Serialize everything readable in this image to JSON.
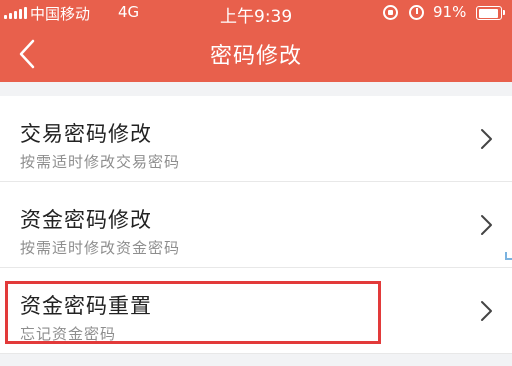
{
  "status_bar": {
    "carrier": "中国移动",
    "network": "4G",
    "time": "上午9:39",
    "battery": "91%",
    "battery_level": 0.91,
    "icons": [
      "signal-icon",
      "rotation-lock-icon",
      "alarm-icon",
      "battery-icon"
    ]
  },
  "nav": {
    "title": "密码修改",
    "back_icon": "chevron-left-icon"
  },
  "items": [
    {
      "title": "交易密码修改",
      "subtitle": "按需适时修改交易密码"
    },
    {
      "title": "资金密码修改",
      "subtitle": "按需适时修改资金密码"
    },
    {
      "title": "资金密码重置",
      "subtitle": "忘记资金密码"
    }
  ],
  "colors": {
    "header": "#e8604c",
    "highlight": "#e23a3a",
    "background": "#f2f3f5"
  }
}
